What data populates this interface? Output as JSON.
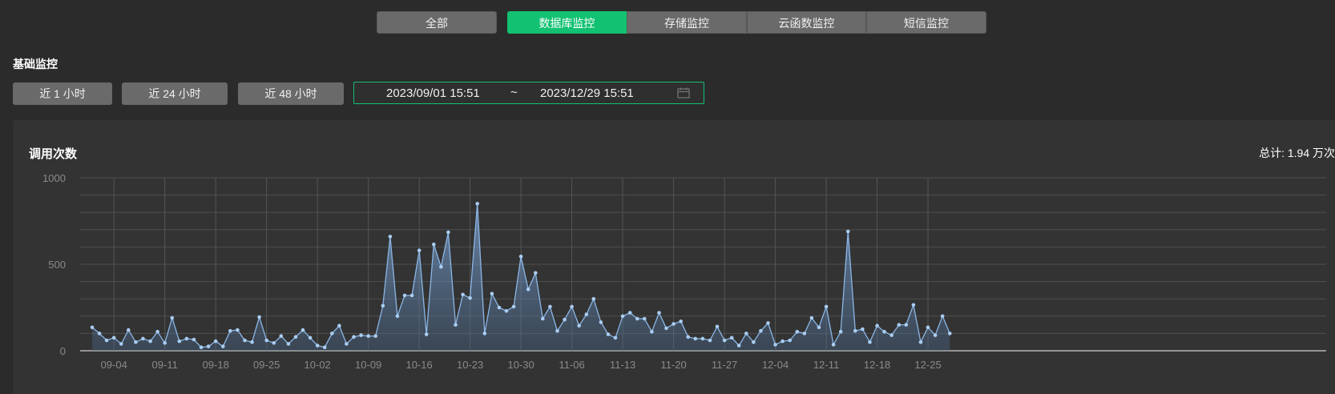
{
  "tabs": {
    "all": "全部",
    "database": "数据库监控",
    "storage": "存储监控",
    "cloud_function": "云函数监控",
    "sms": "短信监控"
  },
  "section_title": "基础监控",
  "ranges": {
    "h1": "近 1 小时",
    "h24": "近 24 小时",
    "h48": "近 48 小时"
  },
  "date_range": {
    "start": "2023/09/01 15:51",
    "separator": "~",
    "end": "2023/12/29 15:51",
    "icon": "calendar-icon"
  },
  "panel": {
    "title": "调用次数",
    "total": "总计: 1.94 万次"
  },
  "colors": {
    "accent": "#12c172",
    "line": "#8bb6e6"
  },
  "chart_data": {
    "type": "area",
    "title": "调用次数",
    "ylim": [
      0,
      1000
    ],
    "y_ticks": [
      "0",
      "500",
      "1000"
    ],
    "x_tick_labels": [
      "09-04",
      "09-11",
      "09-18",
      "09-25",
      "10-02",
      "10-09",
      "10-16",
      "10-23",
      "10-30",
      "11-06",
      "11-13",
      "11-20",
      "11-27",
      "12-04",
      "12-11",
      "12-18",
      "12-25"
    ],
    "start_date": "2023-09-01",
    "grid": true,
    "values": [
      135,
      100,
      60,
      75,
      40,
      120,
      50,
      70,
      55,
      110,
      45,
      190,
      55,
      70,
      65,
      20,
      25,
      55,
      25,
      115,
      120,
      60,
      50,
      195,
      60,
      45,
      85,
      40,
      80,
      120,
      75,
      30,
      20,
      100,
      145,
      40,
      80,
      90,
      85,
      85,
      260,
      660,
      200,
      320,
      320,
      580,
      95,
      615,
      485,
      685,
      150,
      325,
      305,
      850,
      100,
      330,
      250,
      230,
      255,
      545,
      355,
      450,
      185,
      255,
      115,
      180,
      255,
      145,
      210,
      300,
      165,
      95,
      75,
      200,
      220,
      185,
      185,
      110,
      220,
      130,
      155,
      170,
      80,
      70,
      70,
      60,
      140,
      60,
      75,
      30,
      100,
      50,
      115,
      160,
      35,
      55,
      60,
      110,
      100,
      190,
      135,
      255,
      35,
      110,
      690,
      115,
      125,
      50,
      145,
      110,
      90,
      150,
      150,
      265,
      50,
      135,
      90,
      200,
      100
    ]
  }
}
